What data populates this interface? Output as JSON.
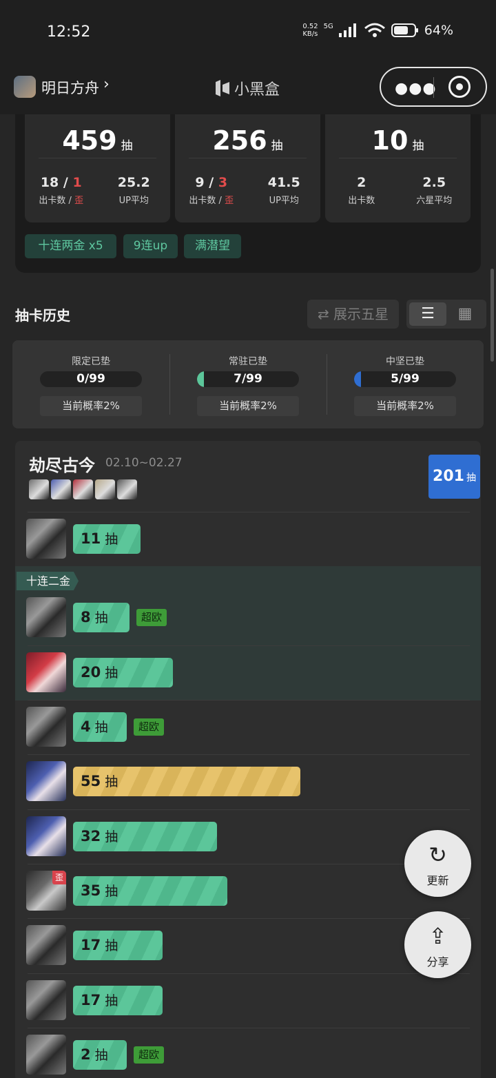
{
  "status_bar": {
    "time": "12:52",
    "net_speed_value": "0.52",
    "net_speed_unit": "KB/s",
    "network": "5G",
    "battery": "64%"
  },
  "nav": {
    "app_name": "明日方舟",
    "brand": "小黑盒"
  },
  "stats": [
    {
      "total": "459",
      "unit": "抽",
      "count": "18",
      "wai": "1",
      "count_label": "出卡数",
      "wai_label": "歪",
      "avg": "25.2",
      "avg_label": "UP平均"
    },
    {
      "total": "256",
      "unit": "抽",
      "count": "9",
      "wai": "3",
      "count_label": "出卡数",
      "wai_label": "歪",
      "avg": "41.5",
      "avg_label": "UP平均"
    },
    {
      "total": "10",
      "unit": "抽",
      "count": "2",
      "count_label": "出卡数",
      "avg": "2.5",
      "avg_label": "六星平均"
    }
  ],
  "tags": [
    "十连两金  x5",
    "9连up",
    "满潜望"
  ],
  "history": {
    "title": "抽卡历史",
    "toggle_label": "⇄ 展示五星"
  },
  "pity": [
    {
      "label": "限定已垫",
      "value": "0/99",
      "progress": 0,
      "rate": "当前概率2%",
      "color": "#5cc69a"
    },
    {
      "label": "常驻已垫",
      "value": "7/99",
      "progress": 0.07,
      "rate": "当前概率2%",
      "color": "#5cc69a"
    },
    {
      "label": "中坚已垫",
      "value": "5/99",
      "progress": 0.05,
      "rate": "当前概率2%",
      "color": "#2f6ed2"
    }
  ],
  "banner": {
    "name": "劫尽古今",
    "dates": "02.10~02.27",
    "total": "201",
    "unit": "抽",
    "ten_label": "十连二金"
  },
  "pulls": [
    {
      "count": "11",
      "unit": "抽",
      "avatar": "gray",
      "bar": "green",
      "ratio": 0.11
    },
    {
      "count": "8",
      "unit": "抽",
      "avatar": "gray",
      "bar": "green",
      "ratio": 0.08,
      "badge": "超欧"
    },
    {
      "count": "20",
      "unit": "抽",
      "avatar": "red",
      "bar": "green",
      "ratio": 0.2
    },
    {
      "count": "4",
      "unit": "抽",
      "avatar": "gray",
      "bar": "green",
      "ratio": 0.04,
      "badge": "超欧"
    },
    {
      "count": "55",
      "unit": "抽",
      "avatar": "blue",
      "bar": "gold",
      "ratio": 0.55
    },
    {
      "count": "32",
      "unit": "抽",
      "avatar": "blue",
      "bar": "green",
      "ratio": 0.32
    },
    {
      "count": "35",
      "unit": "抽",
      "avatar": "dark",
      "bar": "green",
      "ratio": 0.35,
      "wai": "歪"
    },
    {
      "count": "17",
      "unit": "抽",
      "avatar": "gray",
      "bar": "green",
      "ratio": 0.17
    },
    {
      "count": "17",
      "unit": "抽",
      "avatar": "gray",
      "bar": "green",
      "ratio": 0.17
    },
    {
      "count": "2",
      "unit": "抽",
      "avatar": "gray",
      "bar": "green",
      "ratio": 0.02,
      "badge": "超欧"
    }
  ],
  "fab": {
    "refresh": "更新",
    "share": "分享"
  },
  "colors": {
    "accent_green": "#5cc69a",
    "accent_gold": "#e7c36c",
    "accent_blue": "#2f6ed2",
    "danger": "#e24c4c"
  }
}
